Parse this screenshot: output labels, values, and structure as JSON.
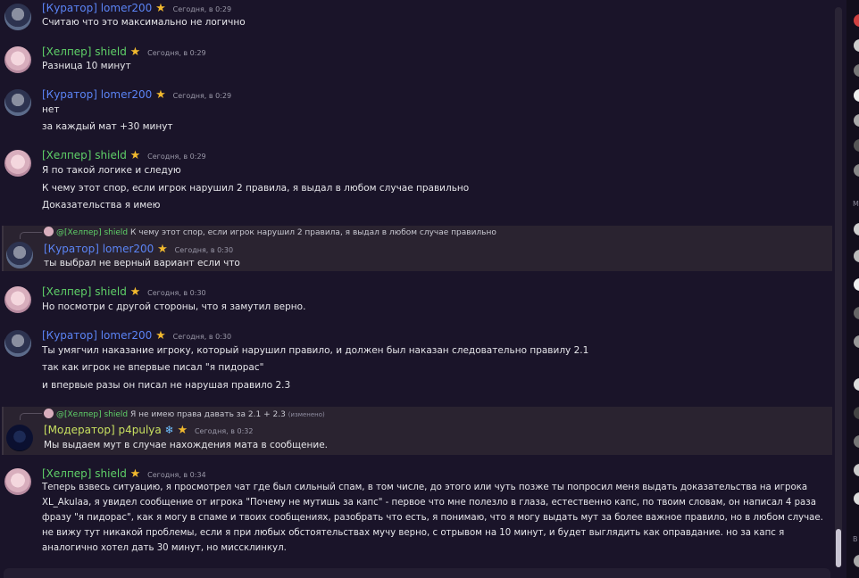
{
  "messages": [
    {
      "author": "[Куратор] lomer200",
      "role": "kur",
      "time": "Сегодня, в 0:29",
      "lines": [
        "Считаю что это максимально не логично"
      ]
    },
    {
      "author": "[Хелпер] shield",
      "role": "helper",
      "time": "Сегодня, в 0:29",
      "lines": [
        "Разница 10 минут"
      ]
    },
    {
      "author": "[Куратор] lomer200",
      "role": "kur",
      "time": "Сегодня, в 0:29",
      "lines": [
        "нет",
        "за каждый мат +30 минут"
      ]
    },
    {
      "author": "[Хелпер] shield",
      "role": "helper",
      "time": "Сегодня, в 0:29",
      "lines": [
        "Я по такой логике и следую",
        "К чему этот спор, если игрок нарушил 2 правила, я выдал в любом случае правильно",
        "Доказательства я имею"
      ]
    },
    {
      "reply": {
        "author": "@[Хелпер] shield",
        "text": "К чему этот спор, если игрок нарушил 2 правила, я выдал в любом случае правильно"
      },
      "author": "[Куратор] lomer200",
      "role": "kur",
      "time": "Сегодня, в 0:30",
      "lines": [
        "ты выбрал не верный вариант если что"
      ]
    },
    {
      "author": "[Хелпер] shield",
      "role": "helper",
      "time": "Сегодня, в 0:30",
      "lines": [
        "Но посмотри с другой стороны, что я замутил верно."
      ]
    },
    {
      "author": "[Куратор] lomer200",
      "role": "kur",
      "time": "Сегодня, в 0:30",
      "lines": [
        "Ты умягчил наказание игроку, который нарушил правило, и должен был наказан следовательно правилу 2.1",
        "так как игрок не впервые писал \"я пидорас\"",
        "и впервые разы он писал не нарушая правило 2.3"
      ]
    },
    {
      "reply": {
        "author": "@[Хелпер] shield",
        "text": "Я не имею права давать за 2.1 + 2.3",
        "edited": "(изменено)"
      },
      "author": "[Модератор] p4pulya",
      "role": "mod",
      "time": "Сегодня, в 0:32",
      "lines": [
        "Мы выдаем мут в случае нахождения мата в сообщение."
      ]
    },
    {
      "author": "[Хелпер] shield",
      "role": "helper",
      "time": "Сегодня, в 0:34",
      "lines": [
        "Теперь взвесь ситуацию, я просмотрел чат где был сильный спам, в том числе, до этого или чуть позже ты попросил меня выдать доказательства на игрока",
        "XL_Akulaa, я увидел сообщение от игрока \"Почему не мутишь за капс\" - первое что мне полезло в глаза, естественно капс, по твоим словам, он написал 4 раза",
        "фразу \"я пидорас\", как я могу в спаме и твоих сообщениях, разобрать что есть, я понимаю, что я могу выдать мут за более важное правило, но в любом случае.",
        "не вижу тут никакой проблемы, если я при любых обстоятельствах мучу верно, с отрывом на 10 минут, и будет выглядить как оправдание. но за капс я",
        "аналогично хотел дать 30 минут, но миссклинкул."
      ]
    }
  ],
  "members": {
    "section_m": "М",
    "section_b": "В"
  },
  "colors": {
    "background": "#1a1429",
    "curator": "#5b84f5",
    "helper": "#5fd068",
    "moderator": "#c8e060"
  }
}
